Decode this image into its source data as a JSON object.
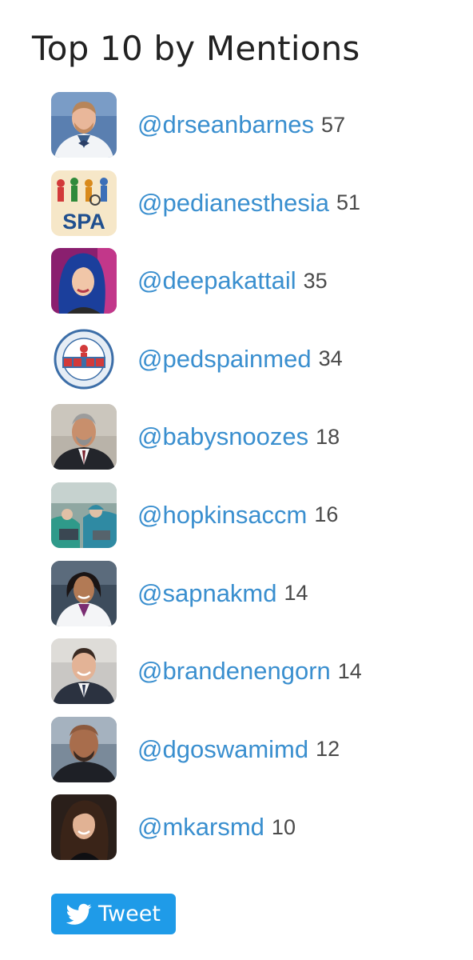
{
  "widget": {
    "title": "Top 10 by Mentions"
  },
  "mentions": [
    {
      "handle": "@drseanbarnes",
      "count": "57",
      "avatar": "avatar-man-white-coat-bowtie"
    },
    {
      "handle": "@pedianesthesia",
      "count": "51",
      "avatar": "avatar-spa-logo"
    },
    {
      "handle": "@deepakattail",
      "count": "35",
      "avatar": "avatar-woman-blue-hair"
    },
    {
      "handle": "@pedspainmed",
      "count": "34",
      "avatar": "avatar-sppm-seal"
    },
    {
      "handle": "@babysnoozes",
      "count": "18",
      "avatar": "avatar-man-suit"
    },
    {
      "handle": "@hopkinsaccm",
      "count": "16",
      "avatar": "avatar-operating-room"
    },
    {
      "handle": "@sapnakmd",
      "count": "14",
      "avatar": "avatar-woman-white-coat"
    },
    {
      "handle": "@brandenengorn",
      "count": "14",
      "avatar": "avatar-man-suit-smiling"
    },
    {
      "handle": "@dgoswamimd",
      "count": "12",
      "avatar": "avatar-man-bald"
    },
    {
      "handle": "@mkarsmd",
      "count": "10",
      "avatar": "avatar-woman-dark-hair"
    }
  ],
  "tweet_button": {
    "label": "Tweet",
    "icon": "twitter-bird-icon",
    "color": "#1f9be8"
  },
  "colors": {
    "link": "#3a8fcf",
    "count": "#4a4a4a",
    "title": "#222222"
  }
}
